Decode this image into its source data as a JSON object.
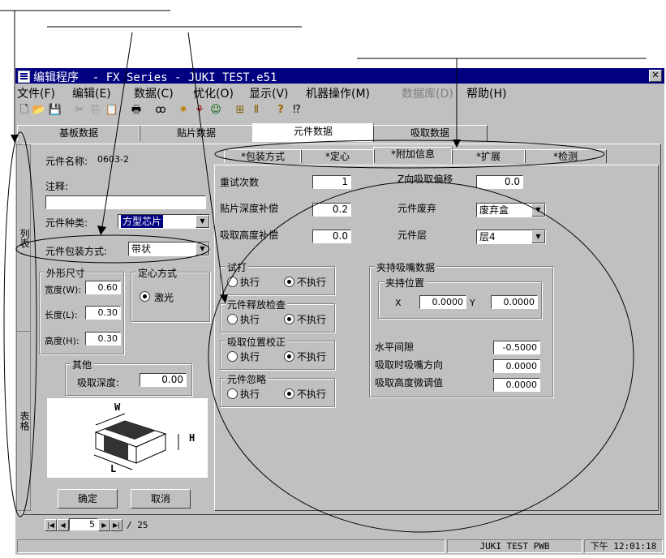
{
  "window": {
    "title": "编辑程序  - FX Series - JUKI_TEST.e51",
    "close_label": "✕"
  },
  "menu": [
    "文件(F)",
    "编辑(E)",
    "数据(C)",
    "优化(O)",
    "显示(V)",
    "机器操作(M)",
    "数据库(D)",
    "帮助(H)"
  ],
  "toolbar": {
    "icons": [
      "new-file-icon",
      "open-folder-icon",
      "save-icon",
      "cut-icon",
      "copy-icon",
      "paste-icon",
      "print-icon",
      "find-icon",
      "light-icon",
      "tree-icon",
      "users-icon",
      "grid-icon",
      "text-icon",
      "help-icon",
      "context-help-icon"
    ],
    "glyphs": [
      "🗋",
      "📂",
      "💾",
      "✂",
      "⎘",
      "📋",
      "🖶",
      "ꝏ",
      "✷",
      "⚘",
      "☺",
      "⊞",
      "Ⅱ",
      "?",
      "⁉"
    ]
  },
  "main_tabs": [
    "基板数据",
    "贴片数据",
    "元件数据",
    "吸取数据"
  ],
  "side_tabs": [
    "列表",
    "表格"
  ],
  "left": {
    "part_name_label": "元件名称:",
    "part_name_value": "0603-2",
    "note_label": "注释:",
    "note_value": "",
    "part_type_label": "元件种类:",
    "part_type_value": "方型芯片",
    "package_label": "元件包装方式:",
    "package_value": "带状",
    "outline_title": "外形尺寸",
    "width_label": "宽度(W):",
    "width_value": "0.60",
    "length_label": "长度(L):",
    "length_value": "0.30",
    "height_label": "高度(H):",
    "height_value": "0.30",
    "centering_title": "定心方式",
    "centering_option": "激光",
    "other_title": "其他",
    "pick_depth_label": "吸取深度:",
    "pick_depth_value": "0.00",
    "diagram_labels": {
      "w": "W",
      "h": "H",
      "l": "L"
    },
    "ok_label": "确定",
    "cancel_label": "取消"
  },
  "sub_tabs": [
    "*包装方式",
    "*定心",
    "*附加信息",
    "*扩展",
    "*检测"
  ],
  "right": {
    "retry_label": "重试次数",
    "retry_value": "1",
    "zoffset_label": "Z向吸取偏移",
    "zoffset_value": "0.0",
    "depth_comp_label": "贴片深度补偿",
    "depth_comp_value": "0.2",
    "discard_label": "元件废弃",
    "discard_value": "废弃盒",
    "pick_height_label": "吸取高度补偿",
    "pick_height_value": "0.0",
    "layer_label": "元件层",
    "layer_value": "层4",
    "groups": [
      {
        "title": "试打",
        "exec": "执行",
        "noexec": "不执行",
        "selected": "noexec"
      },
      {
        "title": "元件释放检查",
        "exec": "执行",
        "noexec": "不执行",
        "selected": "noexec"
      },
      {
        "title": "吸取位置校正",
        "exec": "执行",
        "noexec": "不执行",
        "selected": "noexec"
      },
      {
        "title": "元件忽略",
        "exec": "执行",
        "noexec": "不执行",
        "selected": "noexec"
      }
    ],
    "gripper_title": "夹持吸嘴数据",
    "grip_pos_title": "夹持位置",
    "x_label": "X",
    "x_value": "0.0000",
    "y_label": "Y",
    "y_value": "0.0000",
    "hgap_label": "水平间隙",
    "hgap_value": "-0.5000",
    "nozzle_dir_label": "吸取时吸嘴方向",
    "nozzle_dir_value": "0.0000",
    "pick_fine_label": "吸取高度微调值",
    "pick_fine_value": "0.0000"
  },
  "navigator": {
    "current": "5",
    "total": "/ 25"
  },
  "status": {
    "board": "JUKI TEST PWB",
    "time": "下午 12:01:18"
  }
}
